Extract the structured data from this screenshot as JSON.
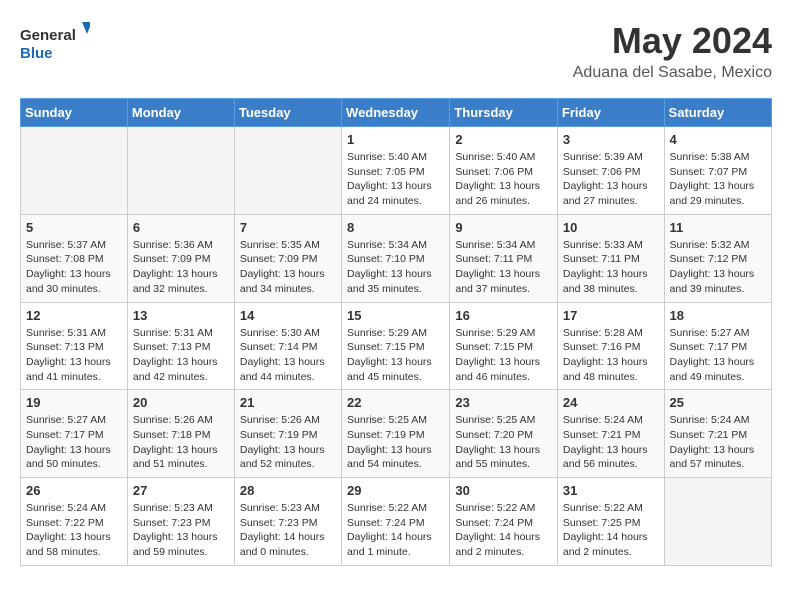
{
  "header": {
    "logo_line1": "General",
    "logo_line2": "Blue",
    "month": "May 2024",
    "location": "Aduana del Sasabe, Mexico"
  },
  "weekdays": [
    "Sunday",
    "Monday",
    "Tuesday",
    "Wednesday",
    "Thursday",
    "Friday",
    "Saturday"
  ],
  "weeks": [
    [
      {
        "day": "",
        "empty": true
      },
      {
        "day": "",
        "empty": true
      },
      {
        "day": "",
        "empty": true
      },
      {
        "day": "1",
        "sunrise": "5:40 AM",
        "sunset": "7:05 PM",
        "daylight": "13 hours and 24 minutes."
      },
      {
        "day": "2",
        "sunrise": "5:40 AM",
        "sunset": "7:06 PM",
        "daylight": "13 hours and 26 minutes."
      },
      {
        "day": "3",
        "sunrise": "5:39 AM",
        "sunset": "7:06 PM",
        "daylight": "13 hours and 27 minutes."
      },
      {
        "day": "4",
        "sunrise": "5:38 AM",
        "sunset": "7:07 PM",
        "daylight": "13 hours and 29 minutes."
      }
    ],
    [
      {
        "day": "5",
        "sunrise": "5:37 AM",
        "sunset": "7:08 PM",
        "daylight": "13 hours and 30 minutes."
      },
      {
        "day": "6",
        "sunrise": "5:36 AM",
        "sunset": "7:09 PM",
        "daylight": "13 hours and 32 minutes."
      },
      {
        "day": "7",
        "sunrise": "5:35 AM",
        "sunset": "7:09 PM",
        "daylight": "13 hours and 34 minutes."
      },
      {
        "day": "8",
        "sunrise": "5:34 AM",
        "sunset": "7:10 PM",
        "daylight": "13 hours and 35 minutes."
      },
      {
        "day": "9",
        "sunrise": "5:34 AM",
        "sunset": "7:11 PM",
        "daylight": "13 hours and 37 minutes."
      },
      {
        "day": "10",
        "sunrise": "5:33 AM",
        "sunset": "7:11 PM",
        "daylight": "13 hours and 38 minutes."
      },
      {
        "day": "11",
        "sunrise": "5:32 AM",
        "sunset": "7:12 PM",
        "daylight": "13 hours and 39 minutes."
      }
    ],
    [
      {
        "day": "12",
        "sunrise": "5:31 AM",
        "sunset": "7:13 PM",
        "daylight": "13 hours and 41 minutes."
      },
      {
        "day": "13",
        "sunrise": "5:31 AM",
        "sunset": "7:13 PM",
        "daylight": "13 hours and 42 minutes."
      },
      {
        "day": "14",
        "sunrise": "5:30 AM",
        "sunset": "7:14 PM",
        "daylight": "13 hours and 44 minutes."
      },
      {
        "day": "15",
        "sunrise": "5:29 AM",
        "sunset": "7:15 PM",
        "daylight": "13 hours and 45 minutes."
      },
      {
        "day": "16",
        "sunrise": "5:29 AM",
        "sunset": "7:15 PM",
        "daylight": "13 hours and 46 minutes."
      },
      {
        "day": "17",
        "sunrise": "5:28 AM",
        "sunset": "7:16 PM",
        "daylight": "13 hours and 48 minutes."
      },
      {
        "day": "18",
        "sunrise": "5:27 AM",
        "sunset": "7:17 PM",
        "daylight": "13 hours and 49 minutes."
      }
    ],
    [
      {
        "day": "19",
        "sunrise": "5:27 AM",
        "sunset": "7:17 PM",
        "daylight": "13 hours and 50 minutes."
      },
      {
        "day": "20",
        "sunrise": "5:26 AM",
        "sunset": "7:18 PM",
        "daylight": "13 hours and 51 minutes."
      },
      {
        "day": "21",
        "sunrise": "5:26 AM",
        "sunset": "7:19 PM",
        "daylight": "13 hours and 52 minutes."
      },
      {
        "day": "22",
        "sunrise": "5:25 AM",
        "sunset": "7:19 PM",
        "daylight": "13 hours and 54 minutes."
      },
      {
        "day": "23",
        "sunrise": "5:25 AM",
        "sunset": "7:20 PM",
        "daylight": "13 hours and 55 minutes."
      },
      {
        "day": "24",
        "sunrise": "5:24 AM",
        "sunset": "7:21 PM",
        "daylight": "13 hours and 56 minutes."
      },
      {
        "day": "25",
        "sunrise": "5:24 AM",
        "sunset": "7:21 PM",
        "daylight": "13 hours and 57 minutes."
      }
    ],
    [
      {
        "day": "26",
        "sunrise": "5:24 AM",
        "sunset": "7:22 PM",
        "daylight": "13 hours and 58 minutes."
      },
      {
        "day": "27",
        "sunrise": "5:23 AM",
        "sunset": "7:23 PM",
        "daylight": "13 hours and 59 minutes."
      },
      {
        "day": "28",
        "sunrise": "5:23 AM",
        "sunset": "7:23 PM",
        "daylight": "14 hours and 0 minutes."
      },
      {
        "day": "29",
        "sunrise": "5:22 AM",
        "sunset": "7:24 PM",
        "daylight": "14 hours and 1 minute."
      },
      {
        "day": "30",
        "sunrise": "5:22 AM",
        "sunset": "7:24 PM",
        "daylight": "14 hours and 2 minutes."
      },
      {
        "day": "31",
        "sunrise": "5:22 AM",
        "sunset": "7:25 PM",
        "daylight": "14 hours and 2 minutes."
      },
      {
        "day": "",
        "empty": true
      }
    ]
  ]
}
